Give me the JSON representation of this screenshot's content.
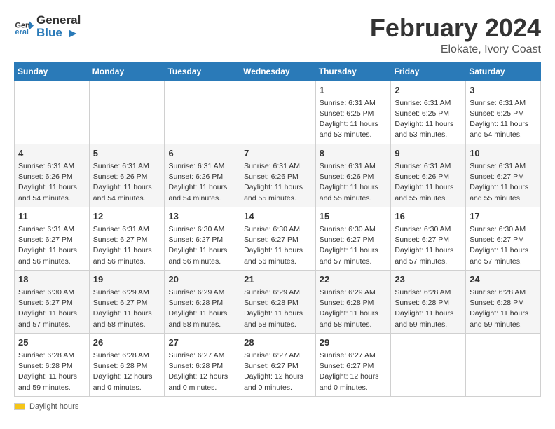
{
  "header": {
    "logo_general": "General",
    "logo_blue": "Blue",
    "main_title": "February 2024",
    "subtitle": "Elokate, Ivory Coast"
  },
  "calendar": {
    "days_of_week": [
      "Sunday",
      "Monday",
      "Tuesday",
      "Wednesday",
      "Thursday",
      "Friday",
      "Saturday"
    ],
    "weeks": [
      [
        {
          "day": "",
          "info": ""
        },
        {
          "day": "",
          "info": ""
        },
        {
          "day": "",
          "info": ""
        },
        {
          "day": "",
          "info": ""
        },
        {
          "day": "1",
          "info": "Sunrise: 6:31 AM\nSunset: 6:25 PM\nDaylight: 11 hours\nand 53 minutes."
        },
        {
          "day": "2",
          "info": "Sunrise: 6:31 AM\nSunset: 6:25 PM\nDaylight: 11 hours\nand 53 minutes."
        },
        {
          "day": "3",
          "info": "Sunrise: 6:31 AM\nSunset: 6:25 PM\nDaylight: 11 hours\nand 54 minutes."
        }
      ],
      [
        {
          "day": "4",
          "info": "Sunrise: 6:31 AM\nSunset: 6:26 PM\nDaylight: 11 hours\nand 54 minutes."
        },
        {
          "day": "5",
          "info": "Sunrise: 6:31 AM\nSunset: 6:26 PM\nDaylight: 11 hours\nand 54 minutes."
        },
        {
          "day": "6",
          "info": "Sunrise: 6:31 AM\nSunset: 6:26 PM\nDaylight: 11 hours\nand 54 minutes."
        },
        {
          "day": "7",
          "info": "Sunrise: 6:31 AM\nSunset: 6:26 PM\nDaylight: 11 hours\nand 55 minutes."
        },
        {
          "day": "8",
          "info": "Sunrise: 6:31 AM\nSunset: 6:26 PM\nDaylight: 11 hours\nand 55 minutes."
        },
        {
          "day": "9",
          "info": "Sunrise: 6:31 AM\nSunset: 6:26 PM\nDaylight: 11 hours\nand 55 minutes."
        },
        {
          "day": "10",
          "info": "Sunrise: 6:31 AM\nSunset: 6:27 PM\nDaylight: 11 hours\nand 55 minutes."
        }
      ],
      [
        {
          "day": "11",
          "info": "Sunrise: 6:31 AM\nSunset: 6:27 PM\nDaylight: 11 hours\nand 56 minutes."
        },
        {
          "day": "12",
          "info": "Sunrise: 6:31 AM\nSunset: 6:27 PM\nDaylight: 11 hours\nand 56 minutes."
        },
        {
          "day": "13",
          "info": "Sunrise: 6:30 AM\nSunset: 6:27 PM\nDaylight: 11 hours\nand 56 minutes."
        },
        {
          "day": "14",
          "info": "Sunrise: 6:30 AM\nSunset: 6:27 PM\nDaylight: 11 hours\nand 56 minutes."
        },
        {
          "day": "15",
          "info": "Sunrise: 6:30 AM\nSunset: 6:27 PM\nDaylight: 11 hours\nand 57 minutes."
        },
        {
          "day": "16",
          "info": "Sunrise: 6:30 AM\nSunset: 6:27 PM\nDaylight: 11 hours\nand 57 minutes."
        },
        {
          "day": "17",
          "info": "Sunrise: 6:30 AM\nSunset: 6:27 PM\nDaylight: 11 hours\nand 57 minutes."
        }
      ],
      [
        {
          "day": "18",
          "info": "Sunrise: 6:30 AM\nSunset: 6:27 PM\nDaylight: 11 hours\nand 57 minutes."
        },
        {
          "day": "19",
          "info": "Sunrise: 6:29 AM\nSunset: 6:27 PM\nDaylight: 11 hours\nand 58 minutes."
        },
        {
          "day": "20",
          "info": "Sunrise: 6:29 AM\nSunset: 6:28 PM\nDaylight: 11 hours\nand 58 minutes."
        },
        {
          "day": "21",
          "info": "Sunrise: 6:29 AM\nSunset: 6:28 PM\nDaylight: 11 hours\nand 58 minutes."
        },
        {
          "day": "22",
          "info": "Sunrise: 6:29 AM\nSunset: 6:28 PM\nDaylight: 11 hours\nand 58 minutes."
        },
        {
          "day": "23",
          "info": "Sunrise: 6:28 AM\nSunset: 6:28 PM\nDaylight: 11 hours\nand 59 minutes."
        },
        {
          "day": "24",
          "info": "Sunrise: 6:28 AM\nSunset: 6:28 PM\nDaylight: 11 hours\nand 59 minutes."
        }
      ],
      [
        {
          "day": "25",
          "info": "Sunrise: 6:28 AM\nSunset: 6:28 PM\nDaylight: 11 hours\nand 59 minutes."
        },
        {
          "day": "26",
          "info": "Sunrise: 6:28 AM\nSunset: 6:28 PM\nDaylight: 12 hours\nand 0 minutes."
        },
        {
          "day": "27",
          "info": "Sunrise: 6:27 AM\nSunset: 6:28 PM\nDaylight: 12 hours\nand 0 minutes."
        },
        {
          "day": "28",
          "info": "Sunrise: 6:27 AM\nSunset: 6:27 PM\nDaylight: 12 hours\nand 0 minutes."
        },
        {
          "day": "29",
          "info": "Sunrise: 6:27 AM\nSunset: 6:27 PM\nDaylight: 12 hours\nand 0 minutes."
        },
        {
          "day": "",
          "info": ""
        },
        {
          "day": "",
          "info": ""
        }
      ]
    ]
  },
  "footer": {
    "daylight_label": "Daylight hours"
  }
}
